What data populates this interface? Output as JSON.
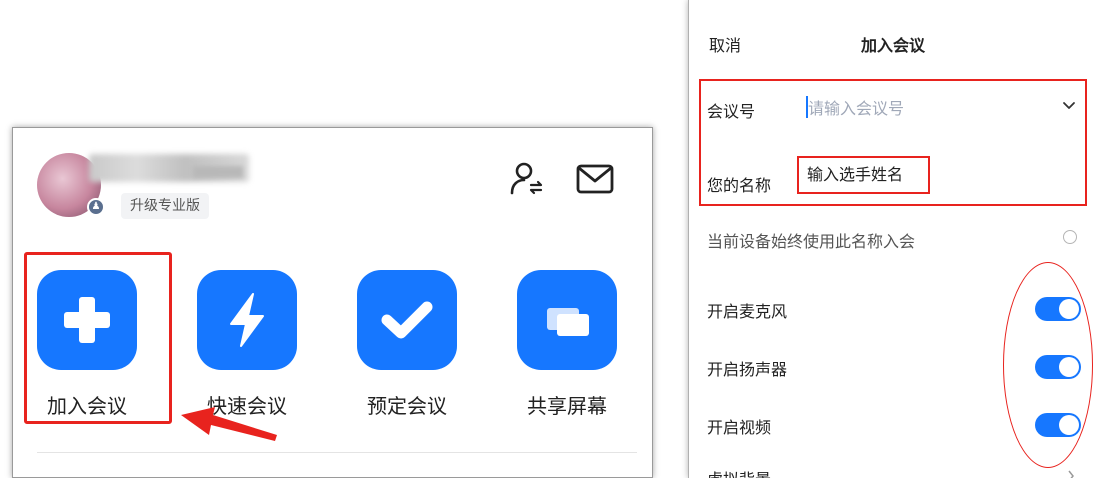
{
  "home": {
    "upgrade_label": "升级专业版",
    "actions": [
      {
        "label": "加入会议",
        "icon": "plus-icon"
      },
      {
        "label": "快速会议",
        "icon": "lightning-icon"
      },
      {
        "label": "预定会议",
        "icon": "checkmark-icon"
      },
      {
        "label": "共享屏幕",
        "icon": "share-screen-icon"
      }
    ],
    "header_icons": [
      "contact-switch-icon",
      "mail-icon"
    ]
  },
  "join_dialog": {
    "cancel_label": "取消",
    "title": "加入会议",
    "meeting_id_label": "会议号",
    "meeting_id_placeholder": "请输入会议号",
    "name_label": "您的名称",
    "name_value": "输入选手姓名",
    "remember_name_label": "当前设备始终使用此名称入会",
    "remember_name_checked": false,
    "toggles": [
      {
        "label": "开启麦克风",
        "on": true
      },
      {
        "label": "开启扬声器",
        "on": true
      },
      {
        "label": "开启视频",
        "on": true
      }
    ],
    "virtual_bg_label": "虚拟背景"
  },
  "colors": {
    "accent": "#1677ff",
    "annotation_red": "#e8231e"
  }
}
